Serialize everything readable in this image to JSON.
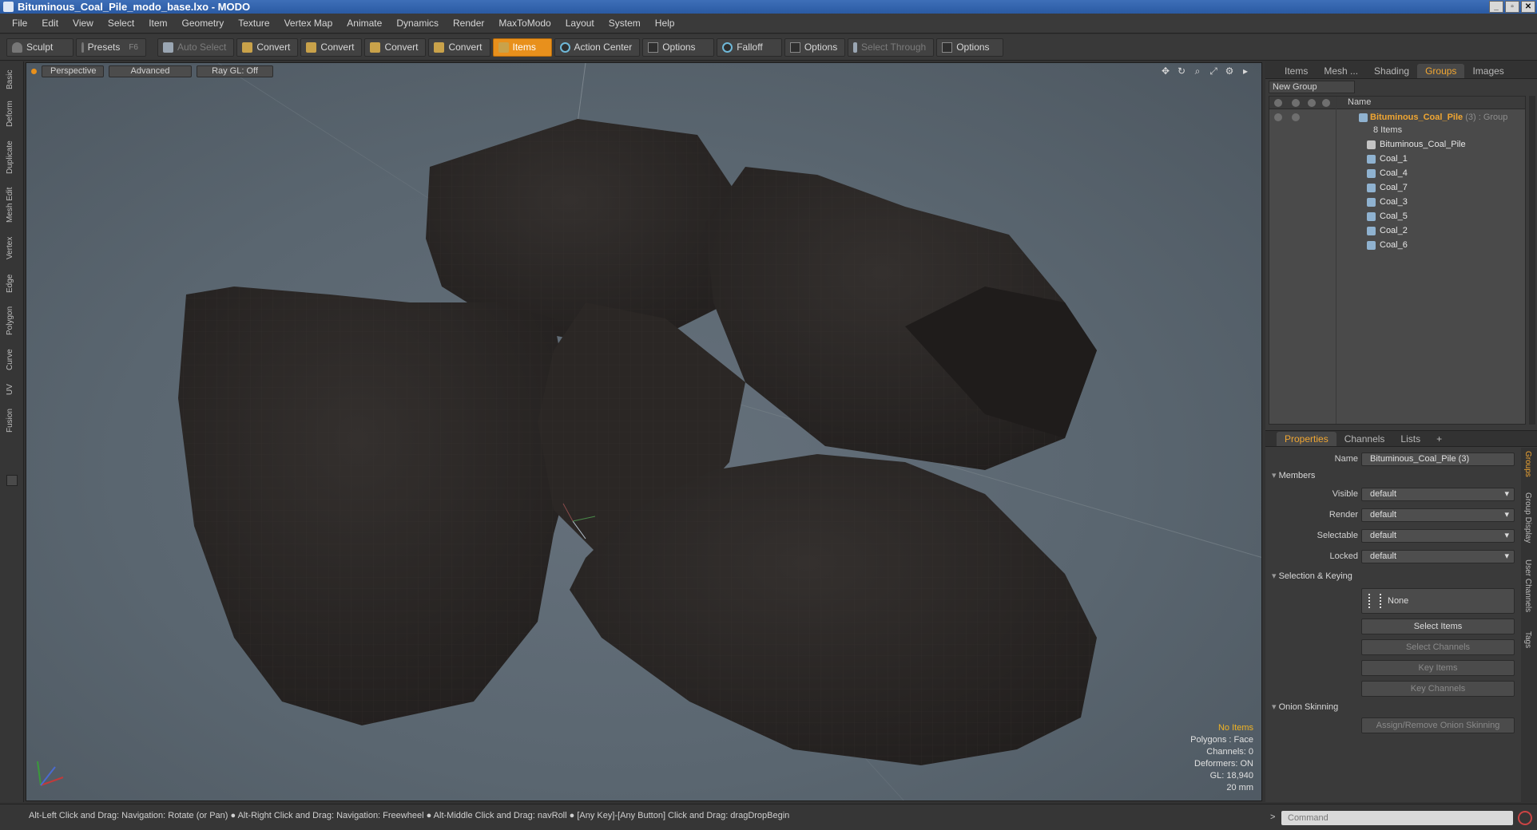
{
  "window": {
    "title": "Bituminous_Coal_Pile_modo_base.lxo - MODO",
    "buttons": [
      "_",
      "▫",
      "✕"
    ]
  },
  "menu": [
    "File",
    "Edit",
    "View",
    "Select",
    "Item",
    "Geometry",
    "Texture",
    "Vertex Map",
    "Animate",
    "Dynamics",
    "Render",
    "MaxToModo",
    "Layout",
    "System",
    "Help"
  ],
  "toolbar": {
    "sculpt": "Sculpt",
    "presets": "Presets",
    "presets_key": "F6",
    "auto_select": "Auto Select",
    "convert1": "Convert",
    "convert2": "Convert",
    "convert3": "Convert",
    "convert4": "Convert",
    "items": "Items",
    "action_center": "Action Center",
    "options1": "Options",
    "falloff": "Falloff",
    "options2": "Options",
    "select_through": "Select Through",
    "options3": "Options"
  },
  "left_tabs": [
    "Basic",
    "Deform",
    "Duplicate",
    "Mesh Edit",
    "Vertex",
    "Edge",
    "Polygon",
    "Curve",
    "UV",
    "Fusion"
  ],
  "viewport": {
    "view": "Perspective",
    "shading": "Advanced",
    "raygl": "Ray GL: Off",
    "info": {
      "items": "No Items",
      "polygons": "Polygons : Face",
      "channels": "Channels: 0",
      "deformers": "Deformers: ON",
      "gl": "GL: 18,940",
      "unit": "20 mm"
    }
  },
  "right_tabs": [
    "Items",
    "Mesh ...",
    "Shading",
    "Groups",
    "Images"
  ],
  "groups": {
    "new_group": "New Group",
    "name_col": "Name",
    "group_name": "Bituminous_Coal_Pile",
    "group_suffix": "(3) : Group",
    "count": "8 Items",
    "children": [
      "Bituminous_Coal_Pile",
      "Coal_1",
      "Coal_4",
      "Coal_7",
      "Coal_3",
      "Coal_5",
      "Coal_2",
      "Coal_6"
    ]
  },
  "prop_tabs": [
    "Properties",
    "Channels",
    "Lists",
    "+"
  ],
  "properties": {
    "name_label": "Name",
    "name_value": "Bituminous_Coal_Pile (3)",
    "members": "Members",
    "visible_label": "Visible",
    "visible": "default",
    "render_label": "Render",
    "render": "default",
    "selectable_label": "Selectable",
    "selectable": "default",
    "locked_label": "Locked",
    "locked": "default",
    "sel_keying": "Selection & Keying",
    "none": "None",
    "select_items": "Select Items",
    "select_channels": "Select Channels",
    "key_items": "Key Items",
    "key_channels": "Key Channels",
    "onion": "Onion Skinning",
    "assign_onion": "Assign/Remove Onion Skinning"
  },
  "prop_side_tabs": [
    "Groups",
    "Group Display",
    "User Channels",
    "Tags"
  ],
  "status": "Alt-Left Click and Drag: Navigation: Rotate (or Pan) ● Alt-Right Click and Drag: Navigation: Freewheel ● Alt-Middle Click and Drag: navRoll ● [Any Key]-[Any Button] Click and Drag: dragDropBegin",
  "command_placeholder": "Command",
  "colors": {
    "accent": "#e8901c",
    "group_text": "#f0a632",
    "viewport_bg": "#5d6972",
    "coal": "#2a2624"
  }
}
